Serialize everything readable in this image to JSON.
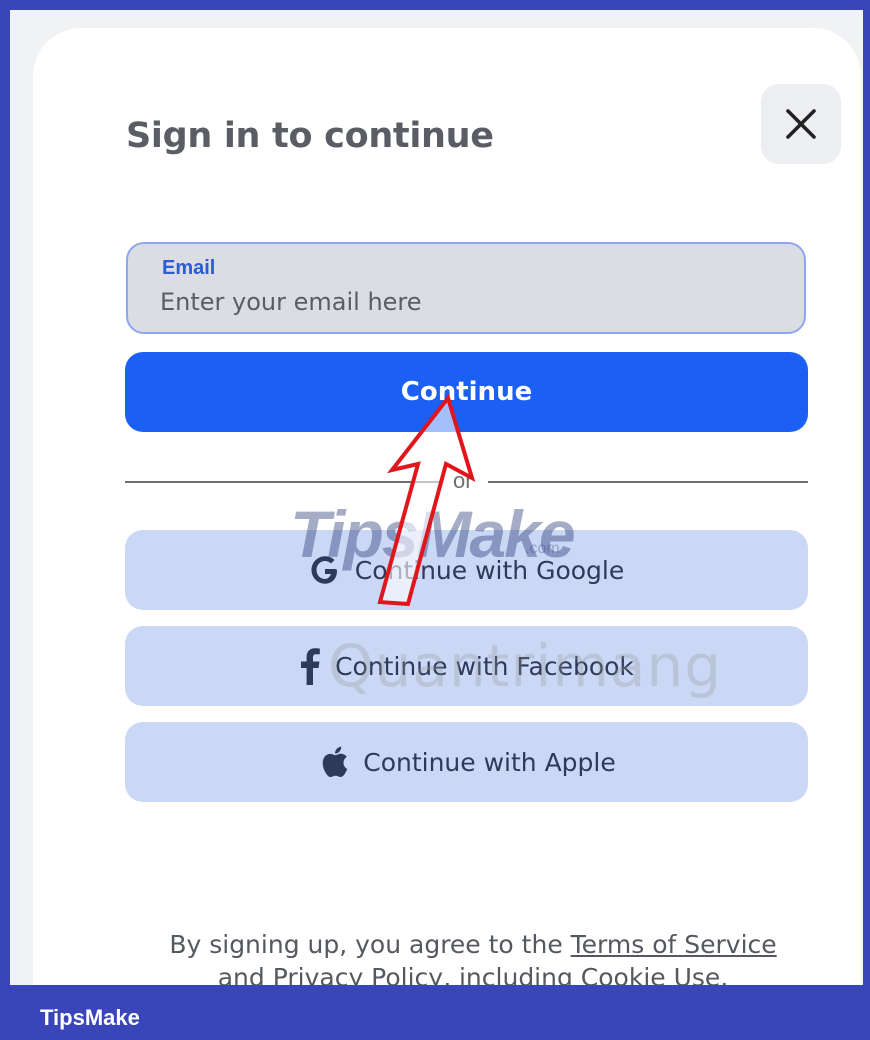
{
  "dialog": {
    "title": "Sign in to continue",
    "close_icon": "close-icon"
  },
  "email": {
    "label": "Email",
    "placeholder": "Enter your email here",
    "value": ""
  },
  "continue": {
    "label": "Continue"
  },
  "divider": {
    "text": "or"
  },
  "social": {
    "google": {
      "label": "Continue with Google",
      "icon": "google-icon"
    },
    "facebook": {
      "label": "Continue with Facebook",
      "icon": "facebook-icon"
    },
    "apple": {
      "label": "Continue with Apple",
      "icon": "apple-icon"
    }
  },
  "legal": {
    "prefix": "By signing up, you agree to the ",
    "terms": "Terms of Service",
    "and": "and ",
    "privacy": "Privacy Policy",
    "middle": ", including ",
    "cookie": "Cookie Use",
    "suffix": "."
  },
  "watermarks": {
    "tipsmake": "TipsMake",
    "tipsmake_sub": ".com",
    "quantrimang": "Quantrimang"
  },
  "footer": {
    "brand": "TipsMake"
  },
  "colors": {
    "frame": "#3a46b8",
    "primary": "#1b5ff5",
    "social_bg": "#cbd8f5",
    "annotation_arrow": "#e0161c"
  }
}
